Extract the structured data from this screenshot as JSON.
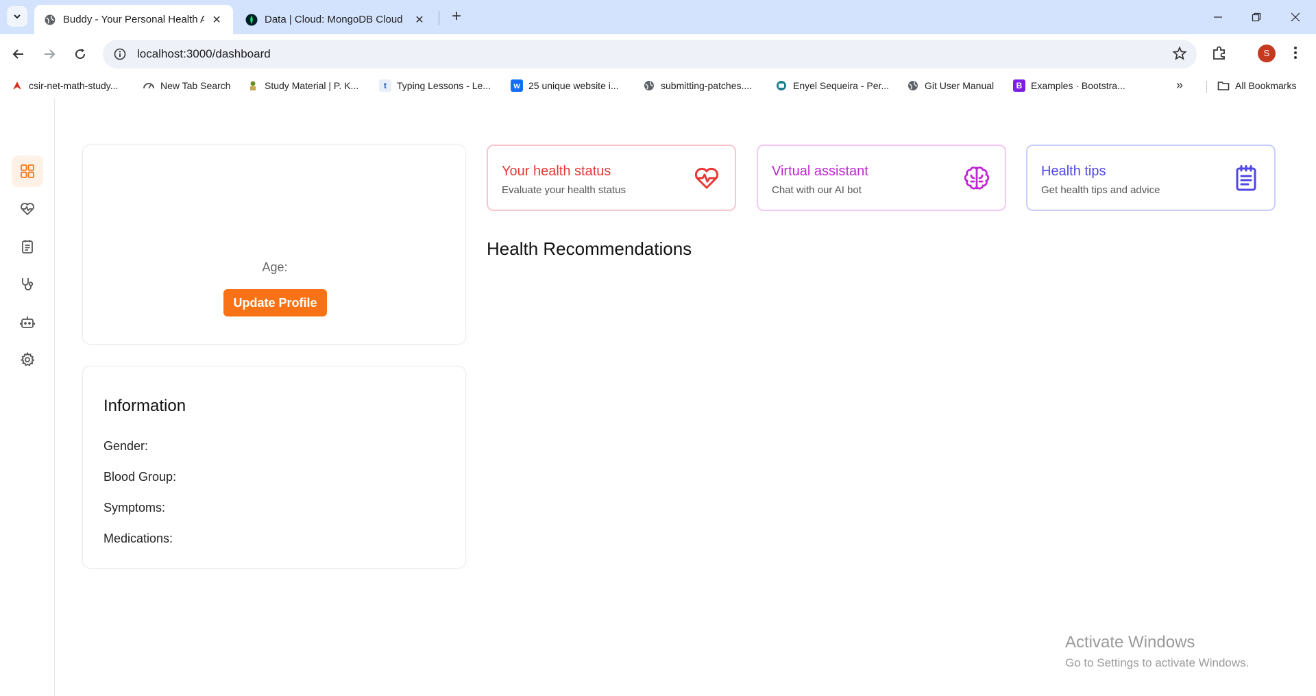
{
  "browser": {
    "tabs": [
      {
        "title": "Buddy - Your Personal Health A",
        "active": true
      },
      {
        "title": "Data | Cloud: MongoDB Cloud",
        "active": false
      }
    ],
    "url": "localhost:3000/dashboard",
    "profile_initial": "S",
    "bookmarks": [
      "csir-net-math-study...",
      "New Tab Search",
      "Study Material | P. K...",
      "Typing Lessons - Le...",
      "25 unique website i...",
      "submitting-patches....",
      "Enyel Sequeira - Per...",
      "Git User Manual",
      "Examples · Bootstra..."
    ],
    "all_bookmarks": "All Bookmarks"
  },
  "sidebar": {
    "items": [
      {
        "icon": "dashboard-grid-icon",
        "active": true
      },
      {
        "icon": "heart-pulse-icon",
        "active": false
      },
      {
        "icon": "clipboard-icon",
        "active": false
      },
      {
        "icon": "stethoscope-icon",
        "active": false
      },
      {
        "icon": "robot-icon",
        "active": false
      },
      {
        "icon": "gear-icon",
        "active": false
      }
    ]
  },
  "profile_card": {
    "age_label": "Age:",
    "update_button": "Update Profile"
  },
  "information": {
    "title": "Information",
    "fields": [
      "Gender:",
      "Blood Group:",
      "Symptoms:",
      "Medications:"
    ]
  },
  "features": [
    {
      "title": "Your health status",
      "subtitle": "Evaluate your health status",
      "color": "#e53935",
      "border": "#f9c6cc",
      "icon": "heart-pulse-icon"
    },
    {
      "title": "Virtual assistant",
      "subtitle": "Chat with our AI bot",
      "color": "#c026d3",
      "border": "#f3c8f5",
      "icon": "brain-icon"
    },
    {
      "title": "Health tips",
      "subtitle": "Get health tips and advice",
      "color": "#4f46e5",
      "border": "#c9cdfb",
      "icon": "clipboard-list-icon"
    }
  ],
  "recommendations": {
    "title": "Health Recommendations"
  },
  "watermark": {
    "line1": "Activate Windows",
    "line2": "Go to Settings to activate Windows."
  },
  "colors": {
    "accent": "#f97316",
    "tabstrip": "#d3e3fd"
  }
}
